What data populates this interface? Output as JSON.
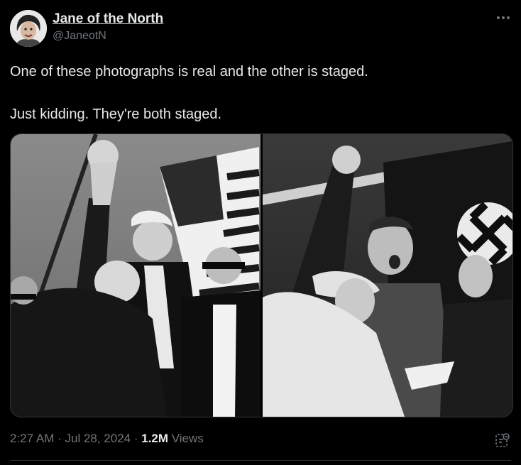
{
  "author": {
    "display_name": "Jane of the North",
    "handle": "@JaneotN"
  },
  "tweet": {
    "line1": "One of these photographs is real and the other is staged.",
    "line2": "Just kidding. They're both staged."
  },
  "meta": {
    "time": "2:27 AM",
    "sep1": " · ",
    "date": "Jul 28, 2024",
    "sep2": " · ",
    "views_count": "1.2M",
    "views_label": " Views"
  },
  "icons": {
    "more": "more-horizontal-icon",
    "analytics": "analytics-icon"
  },
  "colors": {
    "background": "#000000",
    "text": "#e7e9ea",
    "secondary": "#71767b",
    "border": "#2f3336"
  }
}
